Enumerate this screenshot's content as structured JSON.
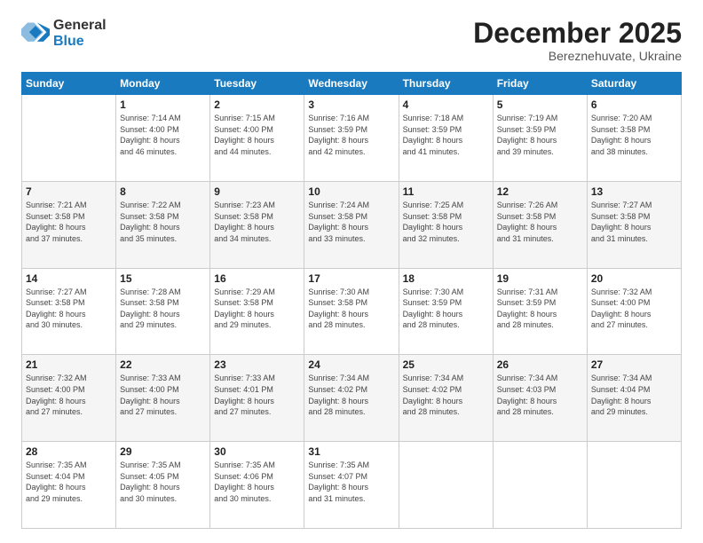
{
  "logo": {
    "general": "General",
    "blue": "Blue"
  },
  "header": {
    "month": "December 2025",
    "location": "Bereznehuvate, Ukraine"
  },
  "weekdays": [
    "Sunday",
    "Monday",
    "Tuesday",
    "Wednesday",
    "Thursday",
    "Friday",
    "Saturday"
  ],
  "weeks": [
    [
      {
        "day": "",
        "sunrise": "",
        "sunset": "",
        "daylight": ""
      },
      {
        "day": "1",
        "sunrise": "Sunrise: 7:14 AM",
        "sunset": "Sunset: 4:00 PM",
        "daylight": "Daylight: 8 hours and 46 minutes."
      },
      {
        "day": "2",
        "sunrise": "Sunrise: 7:15 AM",
        "sunset": "Sunset: 4:00 PM",
        "daylight": "Daylight: 8 hours and 44 minutes."
      },
      {
        "day": "3",
        "sunrise": "Sunrise: 7:16 AM",
        "sunset": "Sunset: 3:59 PM",
        "daylight": "Daylight: 8 hours and 42 minutes."
      },
      {
        "day": "4",
        "sunrise": "Sunrise: 7:18 AM",
        "sunset": "Sunset: 3:59 PM",
        "daylight": "Daylight: 8 hours and 41 minutes."
      },
      {
        "day": "5",
        "sunrise": "Sunrise: 7:19 AM",
        "sunset": "Sunset: 3:59 PM",
        "daylight": "Daylight: 8 hours and 39 minutes."
      },
      {
        "day": "6",
        "sunrise": "Sunrise: 7:20 AM",
        "sunset": "Sunset: 3:58 PM",
        "daylight": "Daylight: 8 hours and 38 minutes."
      }
    ],
    [
      {
        "day": "7",
        "sunrise": "Sunrise: 7:21 AM",
        "sunset": "Sunset: 3:58 PM",
        "daylight": "Daylight: 8 hours and 37 minutes."
      },
      {
        "day": "8",
        "sunrise": "Sunrise: 7:22 AM",
        "sunset": "Sunset: 3:58 PM",
        "daylight": "Daylight: 8 hours and 35 minutes."
      },
      {
        "day": "9",
        "sunrise": "Sunrise: 7:23 AM",
        "sunset": "Sunset: 3:58 PM",
        "daylight": "Daylight: 8 hours and 34 minutes."
      },
      {
        "day": "10",
        "sunrise": "Sunrise: 7:24 AM",
        "sunset": "Sunset: 3:58 PM",
        "daylight": "Daylight: 8 hours and 33 minutes."
      },
      {
        "day": "11",
        "sunrise": "Sunrise: 7:25 AM",
        "sunset": "Sunset: 3:58 PM",
        "daylight": "Daylight: 8 hours and 32 minutes."
      },
      {
        "day": "12",
        "sunrise": "Sunrise: 7:26 AM",
        "sunset": "Sunset: 3:58 PM",
        "daylight": "Daylight: 8 hours and 31 minutes."
      },
      {
        "day": "13",
        "sunrise": "Sunrise: 7:27 AM",
        "sunset": "Sunset: 3:58 PM",
        "daylight": "Daylight: 8 hours and 31 minutes."
      }
    ],
    [
      {
        "day": "14",
        "sunrise": "Sunrise: 7:27 AM",
        "sunset": "Sunset: 3:58 PM",
        "daylight": "Daylight: 8 hours and 30 minutes."
      },
      {
        "day": "15",
        "sunrise": "Sunrise: 7:28 AM",
        "sunset": "Sunset: 3:58 PM",
        "daylight": "Daylight: 8 hours and 29 minutes."
      },
      {
        "day": "16",
        "sunrise": "Sunrise: 7:29 AM",
        "sunset": "Sunset: 3:58 PM",
        "daylight": "Daylight: 8 hours and 29 minutes."
      },
      {
        "day": "17",
        "sunrise": "Sunrise: 7:30 AM",
        "sunset": "Sunset: 3:58 PM",
        "daylight": "Daylight: 8 hours and 28 minutes."
      },
      {
        "day": "18",
        "sunrise": "Sunrise: 7:30 AM",
        "sunset": "Sunset: 3:59 PM",
        "daylight": "Daylight: 8 hours and 28 minutes."
      },
      {
        "day": "19",
        "sunrise": "Sunrise: 7:31 AM",
        "sunset": "Sunset: 3:59 PM",
        "daylight": "Daylight: 8 hours and 28 minutes."
      },
      {
        "day": "20",
        "sunrise": "Sunrise: 7:32 AM",
        "sunset": "Sunset: 4:00 PM",
        "daylight": "Daylight: 8 hours and 27 minutes."
      }
    ],
    [
      {
        "day": "21",
        "sunrise": "Sunrise: 7:32 AM",
        "sunset": "Sunset: 4:00 PM",
        "daylight": "Daylight: 8 hours and 27 minutes."
      },
      {
        "day": "22",
        "sunrise": "Sunrise: 7:33 AM",
        "sunset": "Sunset: 4:00 PM",
        "daylight": "Daylight: 8 hours and 27 minutes."
      },
      {
        "day": "23",
        "sunrise": "Sunrise: 7:33 AM",
        "sunset": "Sunset: 4:01 PM",
        "daylight": "Daylight: 8 hours and 27 minutes."
      },
      {
        "day": "24",
        "sunrise": "Sunrise: 7:34 AM",
        "sunset": "Sunset: 4:02 PM",
        "daylight": "Daylight: 8 hours and 28 minutes."
      },
      {
        "day": "25",
        "sunrise": "Sunrise: 7:34 AM",
        "sunset": "Sunset: 4:02 PM",
        "daylight": "Daylight: 8 hours and 28 minutes."
      },
      {
        "day": "26",
        "sunrise": "Sunrise: 7:34 AM",
        "sunset": "Sunset: 4:03 PM",
        "daylight": "Daylight: 8 hours and 28 minutes."
      },
      {
        "day": "27",
        "sunrise": "Sunrise: 7:34 AM",
        "sunset": "Sunset: 4:04 PM",
        "daylight": "Daylight: 8 hours and 29 minutes."
      }
    ],
    [
      {
        "day": "28",
        "sunrise": "Sunrise: 7:35 AM",
        "sunset": "Sunset: 4:04 PM",
        "daylight": "Daylight: 8 hours and 29 minutes."
      },
      {
        "day": "29",
        "sunrise": "Sunrise: 7:35 AM",
        "sunset": "Sunset: 4:05 PM",
        "daylight": "Daylight: 8 hours and 30 minutes."
      },
      {
        "day": "30",
        "sunrise": "Sunrise: 7:35 AM",
        "sunset": "Sunset: 4:06 PM",
        "daylight": "Daylight: 8 hours and 30 minutes."
      },
      {
        "day": "31",
        "sunrise": "Sunrise: 7:35 AM",
        "sunset": "Sunset: 4:07 PM",
        "daylight": "Daylight: 8 hours and 31 minutes."
      },
      {
        "day": "",
        "sunrise": "",
        "sunset": "",
        "daylight": ""
      },
      {
        "day": "",
        "sunrise": "",
        "sunset": "",
        "daylight": ""
      },
      {
        "day": "",
        "sunrise": "",
        "sunset": "",
        "daylight": ""
      }
    ]
  ]
}
